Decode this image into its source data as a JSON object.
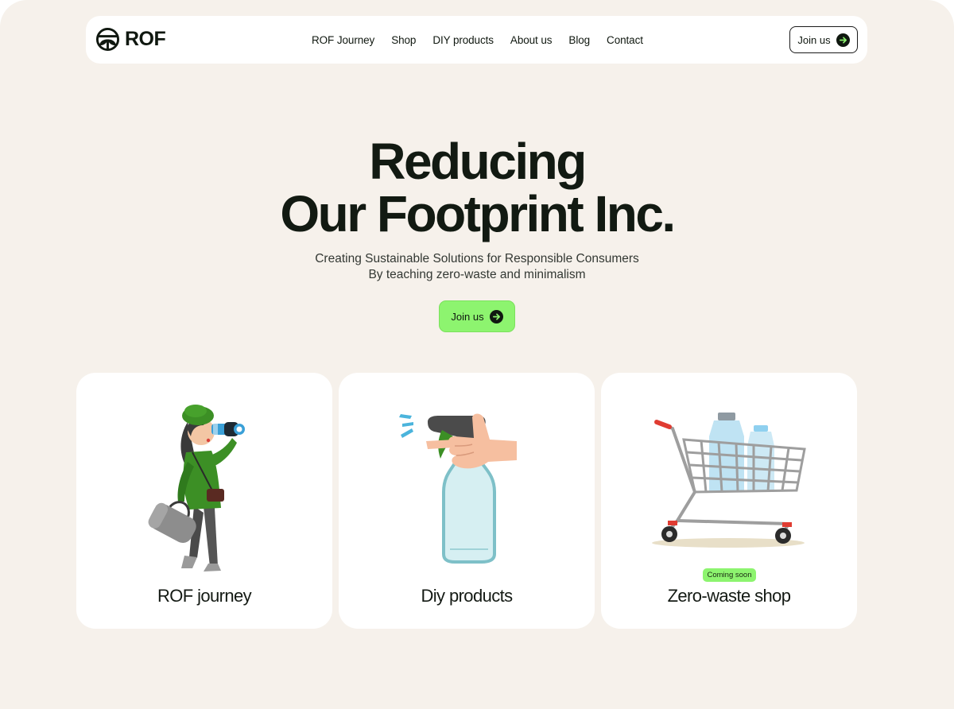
{
  "brand": {
    "name": "ROF"
  },
  "nav": {
    "items": [
      "ROF Journey",
      "Shop",
      "DIY products",
      "About us",
      "Blog",
      "Contact"
    ],
    "join_label": "Join us"
  },
  "hero": {
    "title_line1": "Reducing",
    "title_line2": "Our Footprint Inc.",
    "subtitle_line1": "Creating Sustainable Solutions for Responsible Consumers",
    "subtitle_line2": "By teaching zero-waste and minimalism",
    "cta_label": "Join us"
  },
  "cards": [
    {
      "title": "ROF journey",
      "illustration": "woman-with-binoculars"
    },
    {
      "title": "Diy products",
      "illustration": "spray-bottle-in-hand"
    },
    {
      "title": "Zero-waste shop",
      "badge": "Coming soon",
      "illustration": "shopping-cart-with-bottles"
    }
  ],
  "colors": {
    "background": "#f6f1eb",
    "accent_green": "#8df46f",
    "text_dark": "#121a12"
  },
  "icons": [
    "rof-logo-icon",
    "arrow-right-icon"
  ]
}
